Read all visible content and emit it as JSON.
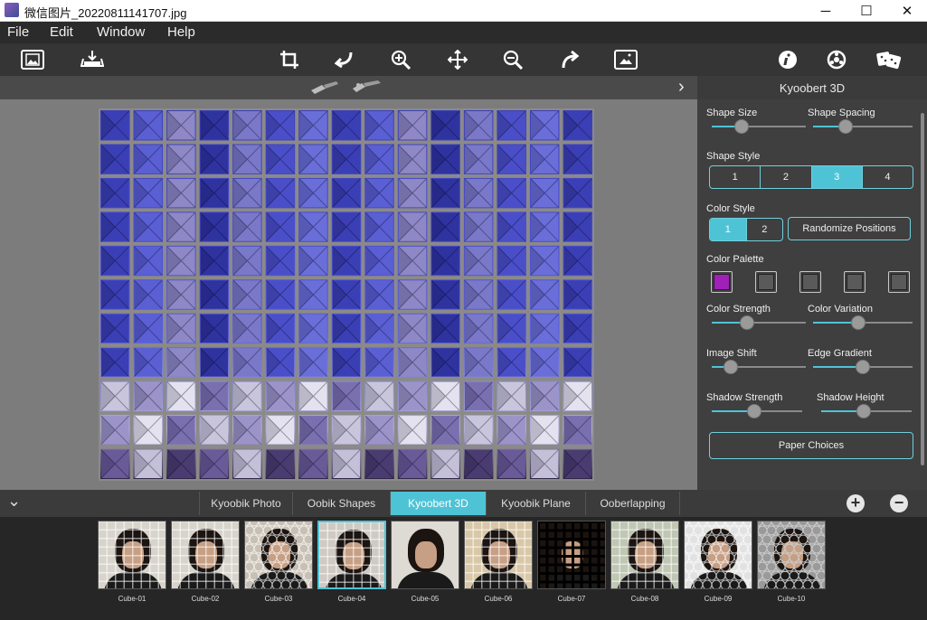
{
  "window": {
    "title": "微信图片_20220811141707.jpg",
    "minimize_glyph": "─",
    "maximize_glyph": "☐",
    "close_glyph": "✕"
  },
  "menu": [
    "File",
    "Edit",
    "Window",
    "Help"
  ],
  "toolbar": {
    "icons": [
      "open-image-icon",
      "save-image-icon",
      "crop-icon",
      "undo-icon",
      "zoom-in-icon",
      "pan-icon",
      "zoom-out-icon",
      "redo-icon",
      "fit-image-icon",
      "info-icon",
      "settings-icon",
      "randomize-dice-icon"
    ]
  },
  "subbar": {
    "expand_glyph": "›"
  },
  "panel": {
    "title": "Kyoobert 3D",
    "shape_size": {
      "label": "Shape Size",
      "value": 0.28
    },
    "shape_spacing": {
      "label": "Shape Spacing",
      "value": 0.3
    },
    "shape_style": {
      "label": "Shape Style",
      "options": [
        "1",
        "2",
        "3",
        "4"
      ],
      "selected": 3
    },
    "color_style": {
      "label": "Color Style",
      "options": [
        "1",
        "2"
      ],
      "selected": 1
    },
    "randomize_label": "Randomize Positions",
    "color_palette": {
      "label": "Color Palette",
      "colors": [
        "#a020b8",
        "#5a5a5a",
        "#5a5a5a",
        "#5a5a5a",
        "#5a5a5a"
      ]
    },
    "color_strength": {
      "label": "Color Strength",
      "value": 0.35
    },
    "color_variation": {
      "label": "Color Variation",
      "value": 0.45
    },
    "image_shift": {
      "label": "Image Shift",
      "value": 0.15
    },
    "edge_gradient": {
      "label": "Edge Gradient",
      "value": 0.5
    },
    "shadow_strength": {
      "label": "Shadow Strength",
      "value": 0.47
    },
    "shadow_height": {
      "label": "Shadow Height",
      "value": 0.47
    },
    "paper_choices_label": "Paper Choices"
  },
  "tabs": {
    "collapse_glyph": "⌄",
    "items": [
      "Kyoobik Photo",
      "Oobik Shapes",
      "Kyoobert 3D",
      "Kyoobik Plane",
      "Ooberlapping"
    ],
    "selected": "Kyoobert 3D",
    "add_glyph": "+",
    "remove_glyph": "−"
  },
  "thumbnails": [
    {
      "caption": "Cube-01",
      "style": "light-grid"
    },
    {
      "caption": "Cube-02",
      "style": "light-grid"
    },
    {
      "caption": "Cube-03",
      "style": "hex"
    },
    {
      "caption": "Cube-04",
      "style": "grid",
      "selected": true
    },
    {
      "caption": "Cube-05",
      "style": "plain"
    },
    {
      "caption": "Cube-06",
      "style": "beige-grid"
    },
    {
      "caption": "Cube-07",
      "style": "dark-grid"
    },
    {
      "caption": "Cube-08",
      "style": "color-noise"
    },
    {
      "caption": "Cube-09",
      "style": "hex-light"
    },
    {
      "caption": "Cube-10",
      "style": "hex-dark"
    }
  ],
  "colors": {
    "accent": "#4fc3d6",
    "panel_bg": "#3f3f3f",
    "canvas_bg": "#7c7c7c"
  }
}
